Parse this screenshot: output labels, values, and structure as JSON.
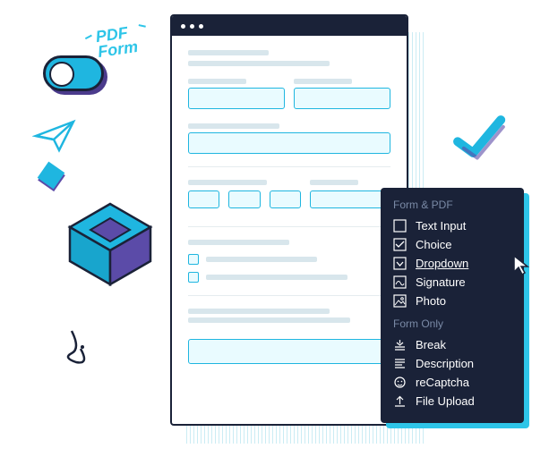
{
  "badge": {
    "line1": "PDF",
    "line2": "Form"
  },
  "menu": {
    "section1": "Form & PDF",
    "section2": "Form Only",
    "items_pdf": [
      {
        "label": "Text Input"
      },
      {
        "label": "Choice"
      },
      {
        "label": "Dropdown"
      },
      {
        "label": "Signature"
      },
      {
        "label": "Photo"
      }
    ],
    "items_form": [
      {
        "label": "Break"
      },
      {
        "label": "Description"
      },
      {
        "label": "reCaptcha"
      },
      {
        "label": "File Upload"
      }
    ]
  }
}
